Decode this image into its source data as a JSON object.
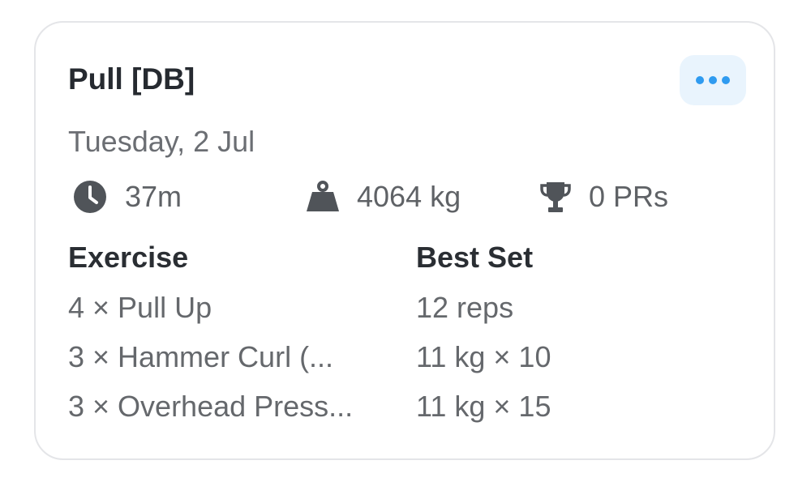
{
  "workout": {
    "title": "Pull [DB]",
    "date": "Tuesday, 2 Jul",
    "menu_icon": "ellipsis-icon"
  },
  "stats": {
    "duration": {
      "icon": "clock-icon",
      "value": "37m"
    },
    "volume": {
      "icon": "weight-icon",
      "value": "4064 kg"
    },
    "prs": {
      "icon": "trophy-icon",
      "value": "0 PRs"
    }
  },
  "table": {
    "headers": [
      "Exercise",
      "Best Set"
    ],
    "rows": [
      {
        "exercise": "4 × Pull Up",
        "best_set": "12 reps"
      },
      {
        "exercise": "3 × Hammer Curl (...",
        "best_set": "11 kg × 10"
      },
      {
        "exercise": "3 × Overhead Press...",
        "best_set": "11 kg × 15"
      }
    ]
  },
  "colors": {
    "accent": "#2f9bf0",
    "menu_bg": "#e9f4fd",
    "title": "#262a30",
    "muted_text": "#65686c",
    "icon": "#505459",
    "card_border": "#e4e5e8"
  }
}
